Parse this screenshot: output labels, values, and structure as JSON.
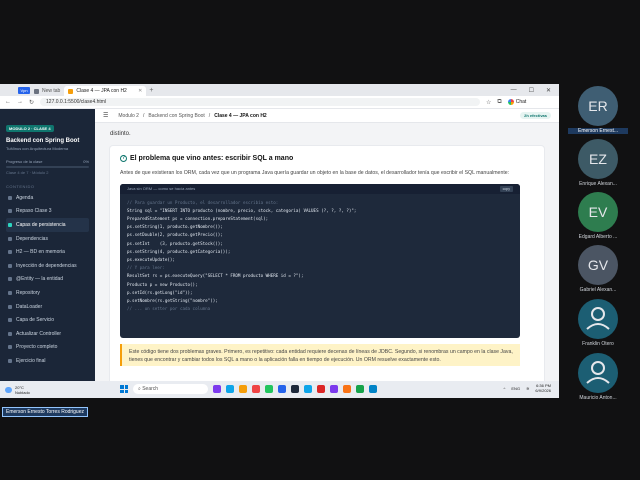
{
  "browser": {
    "vpn_badge": "Vpn",
    "tabs": [
      {
        "label": "New tab",
        "active": false
      },
      {
        "label": "Clase 4 — JPA con H2",
        "active": true
      }
    ],
    "url": "127.0.0.1:5500/clase4.html",
    "chat_label": "Chat"
  },
  "sidebar": {
    "module_badge": "MODULO 2 · CLASE 4",
    "title": "Backend con Spring Boot",
    "subtitle": "TuMinus con Arquitectura Moderna",
    "progress_label": "Progreso de la clase",
    "progress_value": "0%",
    "progress_fraction": 0.0,
    "progress_note": "Clase 4 de 7 · Módulo 2",
    "section_label": "CONTENIDO",
    "items": [
      {
        "label": "Agenda",
        "active": false
      },
      {
        "label": "Repaso Clase 3",
        "active": false
      },
      {
        "label": "Capas de persistencia",
        "active": true
      },
      {
        "label": "Dependencias",
        "active": false
      },
      {
        "label": "H2 — BD en memoria",
        "active": false
      },
      {
        "label": "Inyección de dependencias",
        "active": false
      },
      {
        "label": "@Entity — la entidad",
        "active": false
      },
      {
        "label": "Repository",
        "active": false
      },
      {
        "label": "DataLoader",
        "active": false
      },
      {
        "label": "Capa de Servicio",
        "active": false
      },
      {
        "label": "Actualizar Controller",
        "active": false
      },
      {
        "label": "Proyecto completo",
        "active": false
      },
      {
        "label": "Ejercicio final",
        "active": false
      }
    ]
  },
  "header": {
    "crumbs": [
      "Modulo 2",
      "/",
      "Backend con Spring Boot",
      "/"
    ],
    "current": "Clase 4 — JPA con H2",
    "read_time": "2h efectivas"
  },
  "content": {
    "prev_text": "distinto.",
    "card_title": "El problema que vino antes: escribir SQL a mano",
    "card_para": "Antes de que existieran los ORM, cada vez que un programa Java quería guardar un objeto en la base de datos, el desarrollador tenía que escribir el SQL manualmente:",
    "code_title": "Java sin ORM — como se hacía antes",
    "copy_label": "copy",
    "code_lines": [
      {
        "text": "// Para guardar un Producto, el desarrollador escribía esto:",
        "comment": true
      },
      {
        "text": "String sql = \"INSERT INTO producto (nombre, precio, stock, categoria) VALUES (?, ?, ?, ?)\";",
        "comment": false
      },
      {
        "text": "PreparedStatement ps = connection.prepareStatement(sql);",
        "comment": false
      },
      {
        "text": "ps.setString(1, producto.getNombre());",
        "comment": false
      },
      {
        "text": "ps.setDouble(2, producto.getPrecio());",
        "comment": false
      },
      {
        "text": "ps.setInt    (3, producto.getStock());",
        "comment": false
      },
      {
        "text": "ps.setString(4, producto.getCategoria());",
        "comment": false
      },
      {
        "text": "ps.executeUpdate();",
        "comment": false
      },
      {
        "text": "",
        "comment": false
      },
      {
        "text": "// Y para leer:",
        "comment": true
      },
      {
        "text": "ResultSet rs = ps.executeQuery(\"SELECT * FROM producto WHERE id = ?\");",
        "comment": false
      },
      {
        "text": "Producto p = new Producto();",
        "comment": false
      },
      {
        "text": "p.setId(rs.getLong(\"id\"));",
        "comment": false
      },
      {
        "text": "p.setNombre(rs.getString(\"nombre\"));",
        "comment": false
      },
      {
        "text": "// ... un setter por cada columna",
        "comment": true
      }
    ],
    "callout": "Este código tiene dos problemas graves. Primero, es repetitivo: cada entidad requiere decenas de líneas de JDBC. Segundo, si renombras un campo en la clase Java, tienes que encontrar y cambiar todos los SQL a mano o la aplicación falla en tiempo de ejecución. Un ORM resuelve exactamente esto."
  },
  "taskbar": {
    "temp": "20°C",
    "weather": "Nublado",
    "search_placeholder": "Search",
    "lang": "ENG",
    "time": "6:36 PM",
    "date": "6/9/2026"
  },
  "participants": [
    {
      "initials": "ER",
      "name": "Emerson Ernest...",
      "color": "#3f5e73",
      "type": "initials"
    },
    {
      "initials": "EZ",
      "name": "Enrique Alexan...",
      "color": "#3d5a66",
      "type": "initials"
    },
    {
      "initials": "EV",
      "name": "Edgard Alberto ...",
      "color": "#2e7d4f",
      "type": "initials"
    },
    {
      "initials": "GV",
      "name": "Gabriel Alexan...",
      "color": "#4b5563",
      "type": "initials"
    },
    {
      "initials": "",
      "name": "Franklin Otero",
      "color": "#1c5e73",
      "type": "avatar"
    },
    {
      "initials": "",
      "name": "Mauricio Anton...",
      "color": "#1c5e73",
      "type": "avatar"
    }
  ],
  "presenter_tag": "Emerson Ernesto Torres Rodriguez"
}
